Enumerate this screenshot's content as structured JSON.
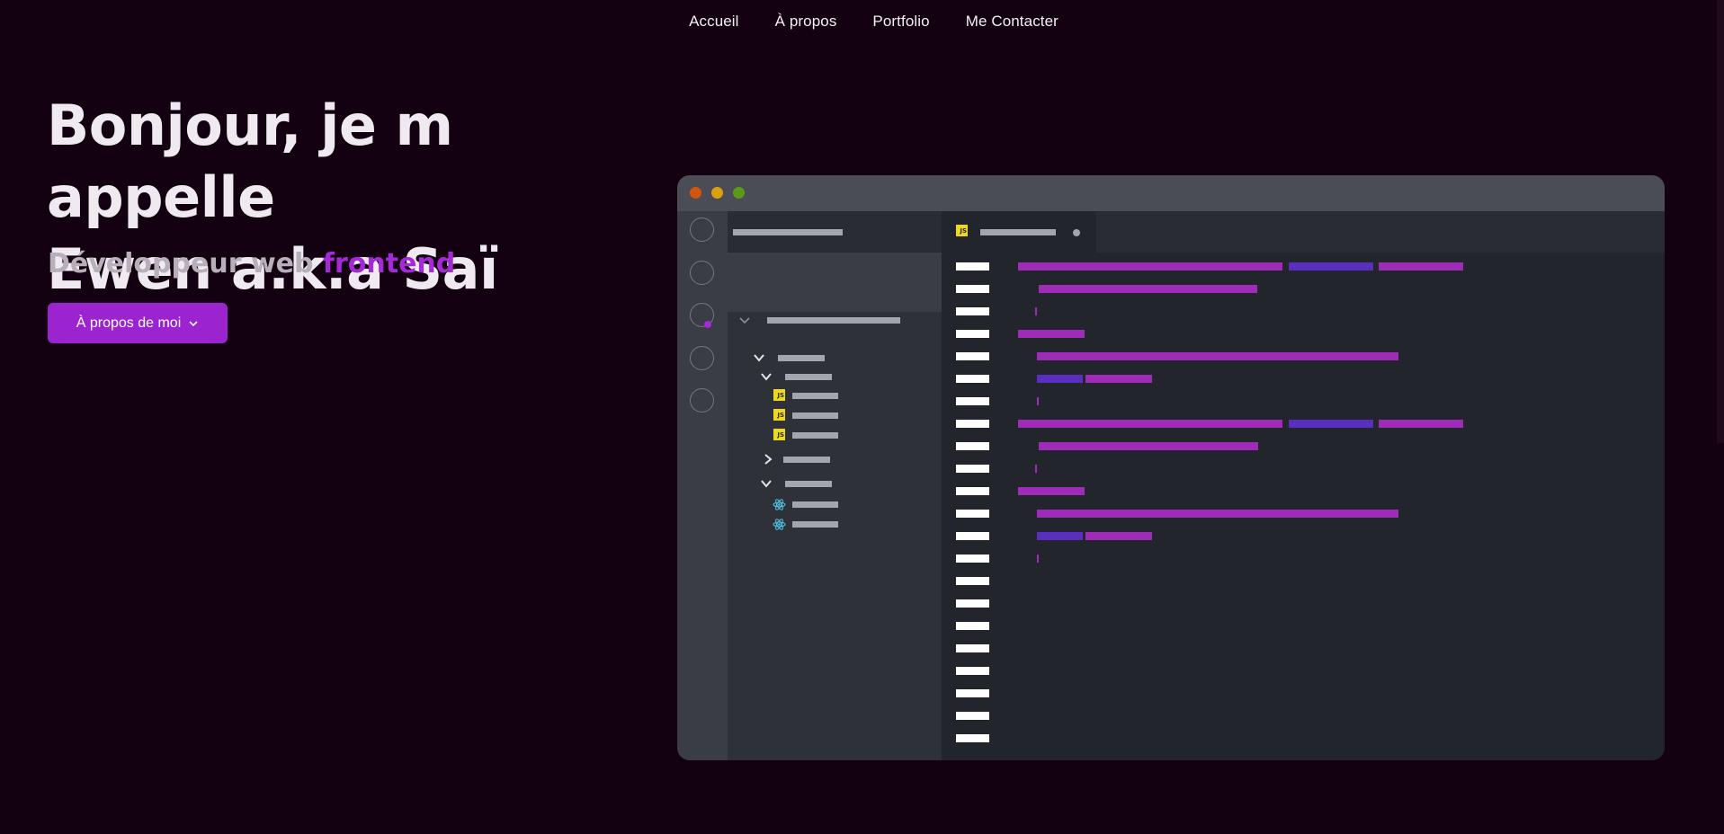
{
  "nav": {
    "items": [
      {
        "label": "Accueil"
      },
      {
        "label": "À propos"
      },
      {
        "label": "Portfolio"
      },
      {
        "label": "Me Contacter"
      }
    ]
  },
  "hero": {
    "title_line1": "Bonjour, je m appelle",
    "title_line2": "Ewen a.k.a Saï",
    "subtitle_prefix": "Développeur web ",
    "subtitle_accent": "frontend",
    "cta_label": "À propos de moi"
  },
  "editor": {
    "window_controls": [
      "close-dot",
      "minimize-dot",
      "maximize-dot"
    ],
    "activity_icons": [
      "circle-icon",
      "circle-icon",
      "circle-icon",
      "circle-icon",
      "circle-icon"
    ],
    "file_badge": "JS",
    "line_count": 22
  },
  "colors": {
    "background": "#130010",
    "accent": "#9b24d0",
    "code_magenta": "#9e2cb8",
    "code_indigo": "#5a2fbd",
    "js_yellow": "#efd81d"
  }
}
